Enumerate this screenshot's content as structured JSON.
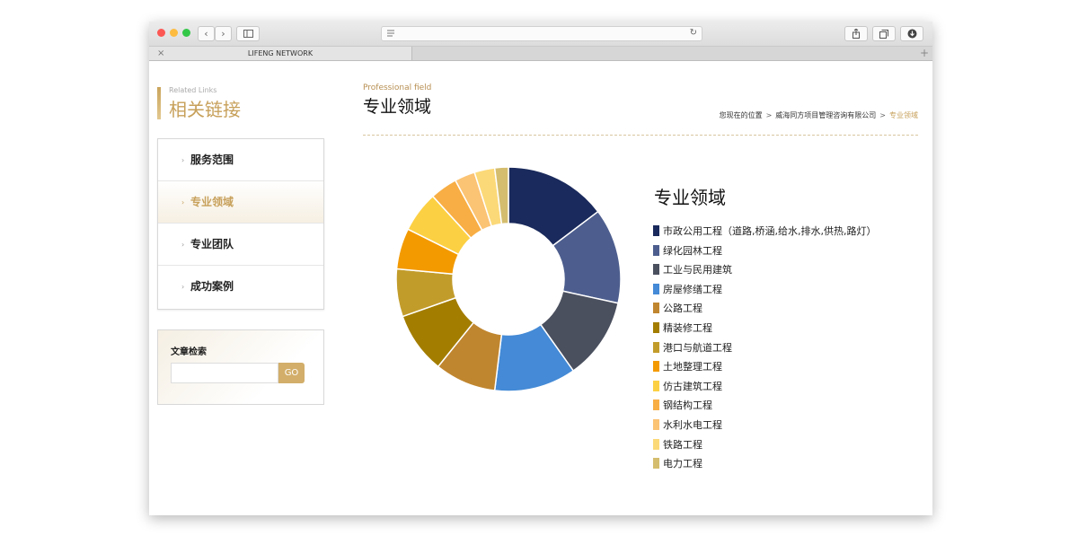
{
  "browser": {
    "tab_title": "LIFENG NETWORK",
    "tab_close": "×",
    "new_tab": "+"
  },
  "sidebar": {
    "title_en": "Related Links",
    "title_cn": "相关链接",
    "menu": [
      {
        "label": "服务范围",
        "active": false
      },
      {
        "label": "专业领域",
        "active": true
      },
      {
        "label": "专业团队",
        "active": false
      },
      {
        "label": "成功案例",
        "active": false
      }
    ],
    "search": {
      "title": "文章检索",
      "button": "GO",
      "value": ""
    }
  },
  "main": {
    "title_en": "Professional field",
    "title_cn": "专业领域",
    "breadcrumb": {
      "prefix": "您现在的位置",
      "company": "威海同方项目管理咨询有限公司",
      "current": "专业领域"
    }
  },
  "chart_data": {
    "type": "pie",
    "title": "专业领域",
    "categories": [
      "市政公用工程（道路,桥涵,给水,排水,供热,路灯）",
      "绿化园林工程",
      "工业与民用建筑",
      "房屋修缮工程",
      "公路工程",
      "精装修工程",
      "港口与航道工程",
      "土地整理工程",
      "仿古建筑工程",
      "钢结构工程",
      "水利水电工程",
      "铁路工程",
      "电力工程"
    ],
    "values": [
      15,
      14,
      12,
      12,
      9,
      9,
      7,
      6,
      6,
      4,
      3,
      3,
      2
    ],
    "colors": [
      "#1a2a5c",
      "#4d5e8e",
      "#4b505f",
      "#448ad6",
      "#c0862f",
      "#a37d00",
      "#c29c2b",
      "#f39a00",
      "#fcd043",
      "#f8ae44",
      "#fbc374",
      "#fcd978",
      "#d4bd6e"
    ],
    "legend_position": "right"
  }
}
